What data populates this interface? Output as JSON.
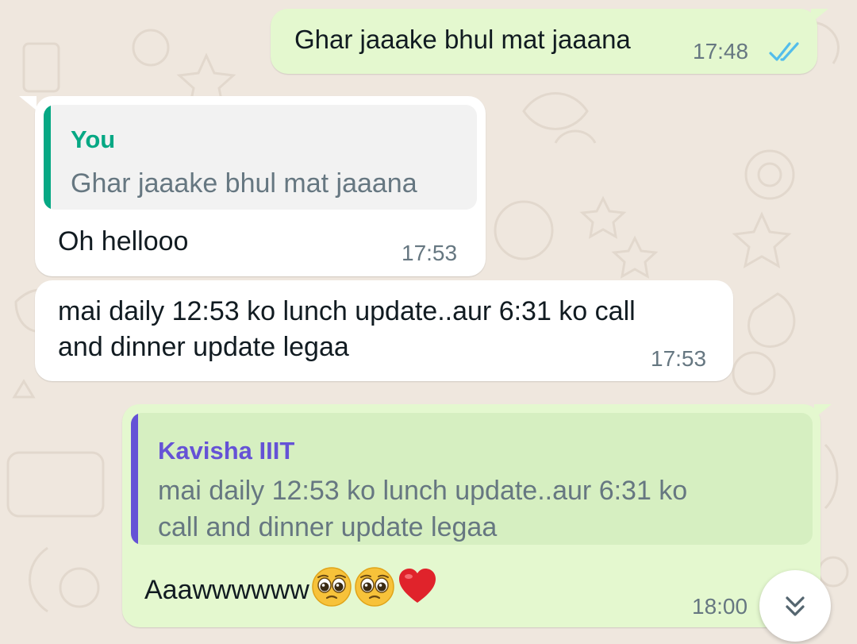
{
  "messages": [
    {
      "direction": "outgoing",
      "text": "Ghar jaaake bhul mat jaaana",
      "time": "17:48",
      "status": "read-double-tick"
    },
    {
      "direction": "incoming",
      "quote": {
        "author": "You",
        "text": "Ghar jaaake bhul mat jaaana"
      },
      "text": "Oh hellooo",
      "time": "17:53"
    },
    {
      "direction": "incoming",
      "text_lines": [
        "mai daily 12:53 ko lunch update..aur 6:31 ko call",
        "and dinner update legaa"
      ],
      "time": "17:53"
    },
    {
      "direction": "outgoing",
      "quote": {
        "author": "Kavisha IIIT",
        "text_lines": [
          "mai daily 12:53 ko lunch update..aur 6:31 ko",
          "call and dinner update legaa"
        ]
      },
      "text": "Aaawwwwww",
      "emojis": [
        "pleading-face-emoji",
        "pleading-face-emoji",
        "red-heart-emoji"
      ],
      "time": "18:00"
    }
  ],
  "scroll_button": {
    "icon": "double-chevron-down-icon"
  },
  "colors": {
    "wallpaper": "#efe7de",
    "outgoing_bubble": "#e4f8cf",
    "incoming_bubble": "#ffffff",
    "outgoing_quote_bg": "#d6efc1",
    "incoming_quote_bg": "#f2f2f2",
    "quote_you_accent": "#06a884",
    "quote_kavisha_accent": "#6552d6",
    "read_tick": "#53bdeb",
    "timestamp": "#667781"
  }
}
